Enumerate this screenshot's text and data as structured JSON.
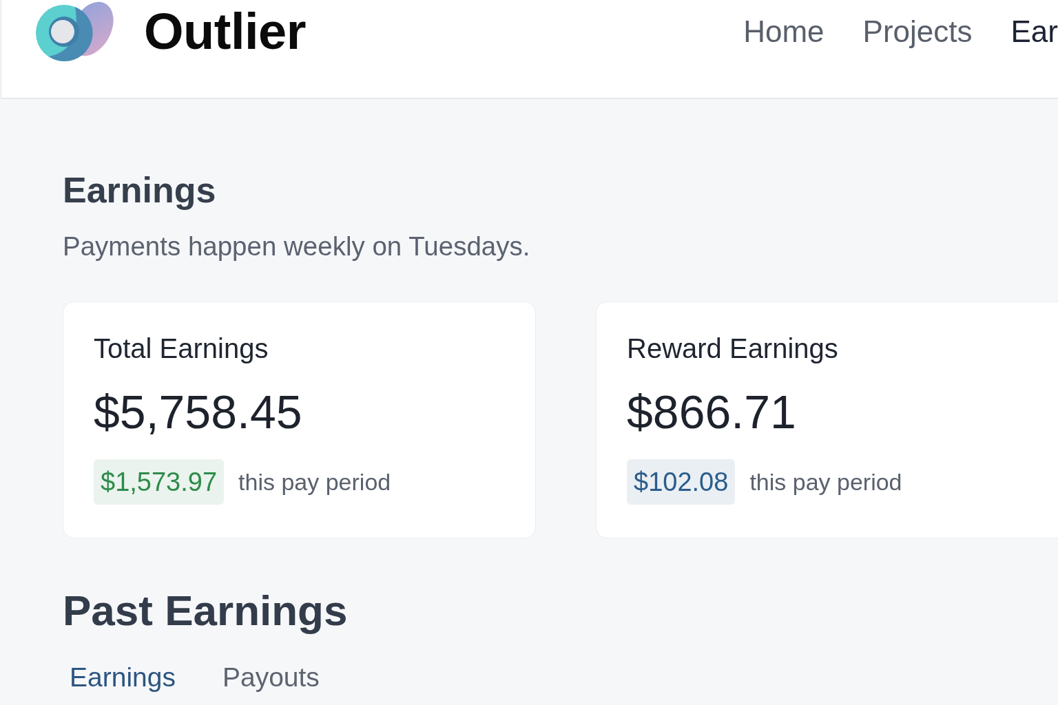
{
  "header": {
    "logo": "Outlier",
    "nav": [
      {
        "label": "Home",
        "selected": false
      },
      {
        "label": "Projects",
        "selected": false
      },
      {
        "label": "Ear",
        "selected": true
      }
    ]
  },
  "page": {
    "title": "Earnings",
    "subtitle": "Payments happen weekly on Tuesdays."
  },
  "cards": [
    {
      "title": "Total Earnings",
      "amount": "$5,758.45",
      "period_amount": "$1,573.97",
      "period_label": "this pay period",
      "color": "#2e8b4a"
    },
    {
      "title": "Reward Earnings",
      "amount": "$866.71",
      "period_amount": "$102.08",
      "period_label": "this pay period",
      "color": "#2a5d8b"
    }
  ],
  "past_earnings": {
    "title": "Past Earnings",
    "tabs": [
      {
        "label": "Earnings",
        "selected": true
      },
      {
        "label": "Payouts",
        "selected": false
      }
    ]
  }
}
